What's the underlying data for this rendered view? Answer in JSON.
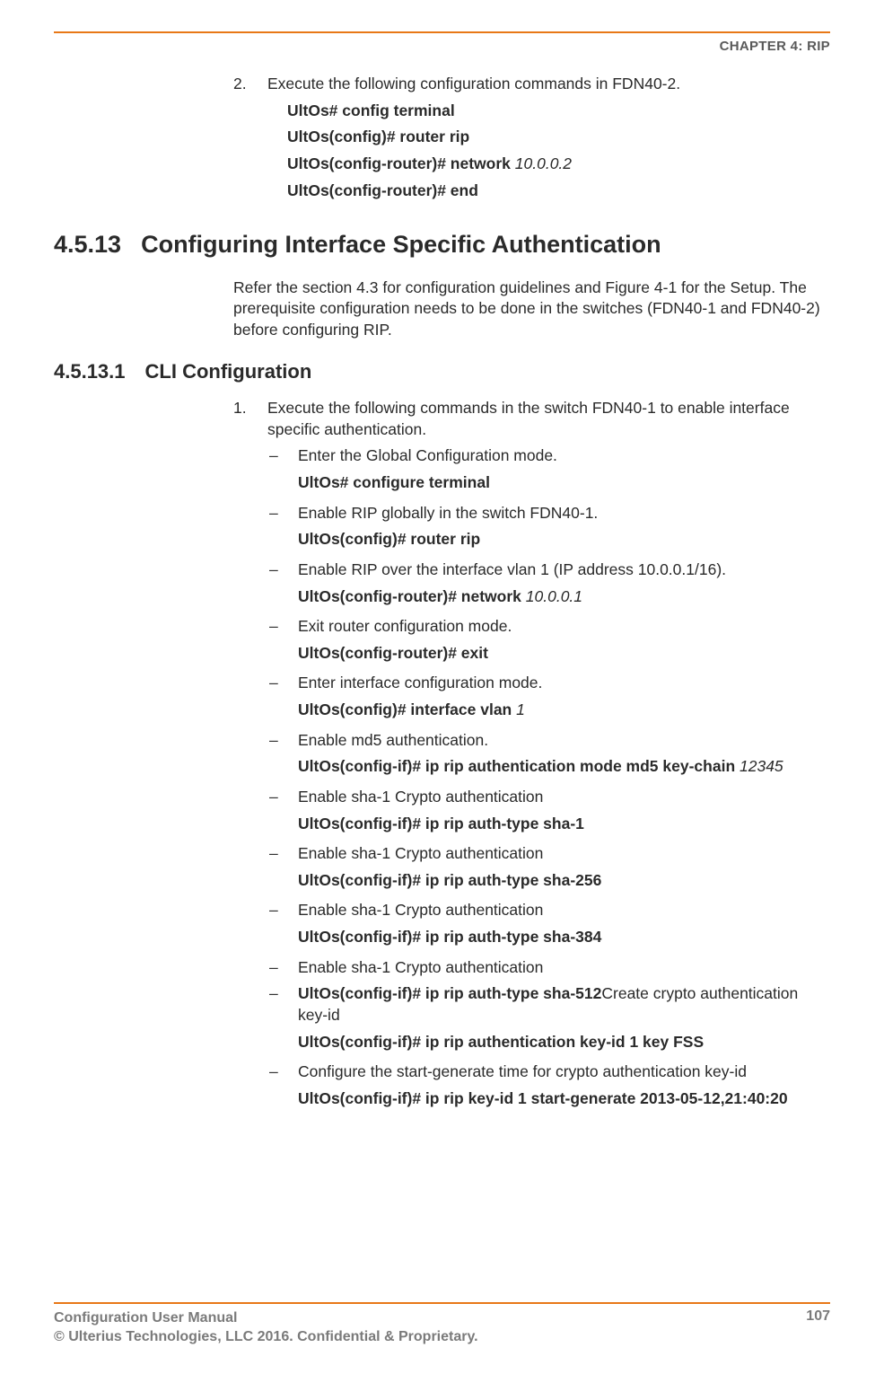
{
  "header": {
    "chapter": "CHAPTER 4: RIP"
  },
  "intro_step": {
    "num": "2.",
    "text": "Execute the following configuration commands in FDN40-2.",
    "cmds": [
      {
        "bold": "UltOs# config terminal",
        "arg": ""
      },
      {
        "bold": "UltOs(config)# router rip",
        "arg": ""
      },
      {
        "bold": "UltOs(config-router)# network",
        "arg": " 10.0.0.2"
      },
      {
        "bold": "UltOs(config-router)# end",
        "arg": ""
      }
    ]
  },
  "h2": {
    "num": "4.5.13",
    "title": "Configuring Interface Specific Authentication"
  },
  "h2_para": "Refer the section 4.3 for configuration guidelines and Figure 4-1 for the Setup. The prerequisite configuration needs to be done in the switches (FDN40-1 and FDN40-2) before configuring RIP.",
  "h3": {
    "num": "4.5.13.1",
    "title": "CLI Configuration"
  },
  "step1": {
    "num": "1.",
    "text": "Execute the following commands in the switch FDN40-1 to enable interface specific authentication.",
    "subs": [
      {
        "desc": "Enter the Global Configuration mode.",
        "bold": "UltOs# configure terminal",
        "arg": ""
      },
      {
        "desc": "Enable RIP globally in the switch FDN40-1.",
        "bold": "UltOs(config)# router rip",
        "arg": ""
      },
      {
        "desc": "Enable RIP over the interface vlan 1 (IP address 10.0.0.1/16).",
        "bold": "UltOs(config-router)# network",
        "arg": " 10.0.0.1"
      },
      {
        "desc": "Exit router configuration mode.",
        "bold": "UltOs(config-router)# exit",
        "arg": ""
      },
      {
        "desc": "Enter interface configuration mode.",
        "bold": "UltOs(config)# interface vlan",
        "arg": " 1"
      },
      {
        "desc": "Enable md5 authentication.",
        "bold": "UltOs(config-if)# ip rip authentication mode md5 key-chain",
        "arg": " 12345"
      },
      {
        "desc": "Enable sha-1 Crypto authentication",
        "bold": "UltOs(config-if)# ip rip auth-type sha-1",
        "arg": ""
      },
      {
        "desc": "Enable sha-1 Crypto authentication",
        "bold": "UltOs(config-if)# ip rip auth-type sha-256",
        "arg": ""
      },
      {
        "desc": "Enable sha-1 Crypto authentication",
        "bold": "UltOs(config-if)# ip rip auth-type sha-384",
        "arg": ""
      },
      {
        "desc": "Enable sha-1 Crypto authentication",
        "bold": "",
        "arg": ""
      }
    ],
    "special_sub": {
      "bold_pre": "UltOs(config-if)# ip rip auth-type sha-512",
      "tail": "Create crypto authentication key-id",
      "cmd": "UltOs(config-if)# ip rip authentication key-id 1 key FSS"
    },
    "last_sub": {
      "desc": "Configure the start-generate time for crypto authentication key-id",
      "cmd": "UltOs(config-if)# ip rip key-id 1 start-generate 2013-05-12,21:40:20"
    }
  },
  "footer": {
    "line1": "Configuration User Manual",
    "line2": "© Ulterius Technologies, LLC 2016. Confidential & Proprietary.",
    "page": "107"
  }
}
